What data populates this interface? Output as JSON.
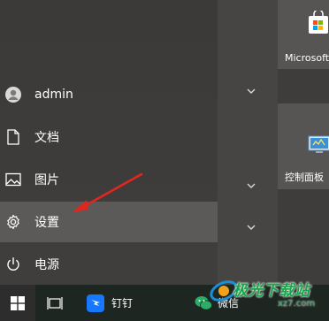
{
  "left_menu": {
    "user": "admin",
    "documents": "文档",
    "pictures": "图片",
    "settings": "设置",
    "power": "电源"
  },
  "tiles": {
    "microsoft_store": "Microsoft",
    "control_panel": "控制面板"
  },
  "taskbar": {
    "app1": "钉钉",
    "app2": "微信"
  },
  "watermark": {
    "text": "极光下载站",
    "url": "xz7.com"
  },
  "colors": {
    "accent_blue": "#1677ff",
    "wechat_green": "#2aae67",
    "arrow_red": "#e0261e"
  }
}
